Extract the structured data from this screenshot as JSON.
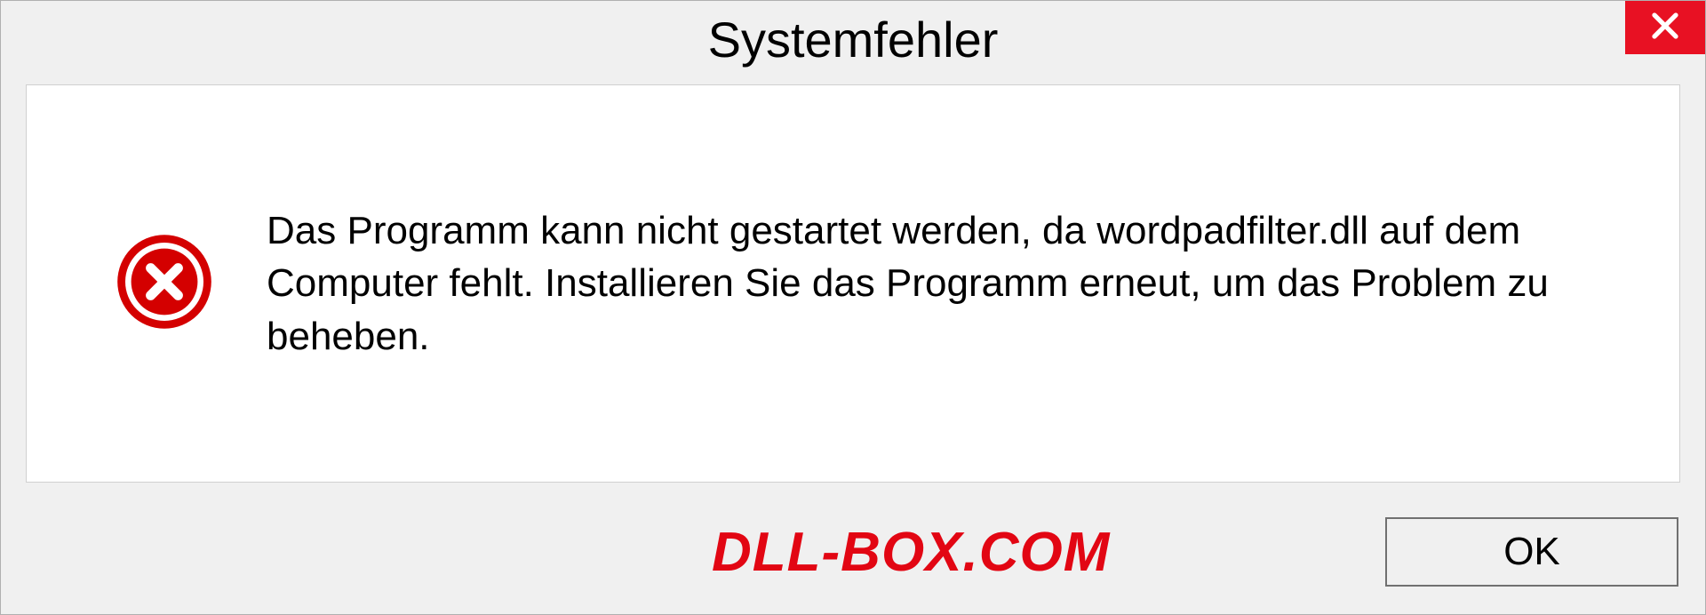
{
  "dialog": {
    "title": "Systemfehler",
    "message": "Das Programm kann nicht gestartet werden, da wordpadfilter.dll auf dem Computer fehlt. Installieren Sie das Programm erneut, um das Problem zu beheben.",
    "ok_label": "OK"
  },
  "watermark": {
    "text": "DLL-BOX.COM"
  },
  "colors": {
    "close_bg": "#e81123",
    "error_red": "#d40000",
    "watermark_red": "#e20613"
  }
}
